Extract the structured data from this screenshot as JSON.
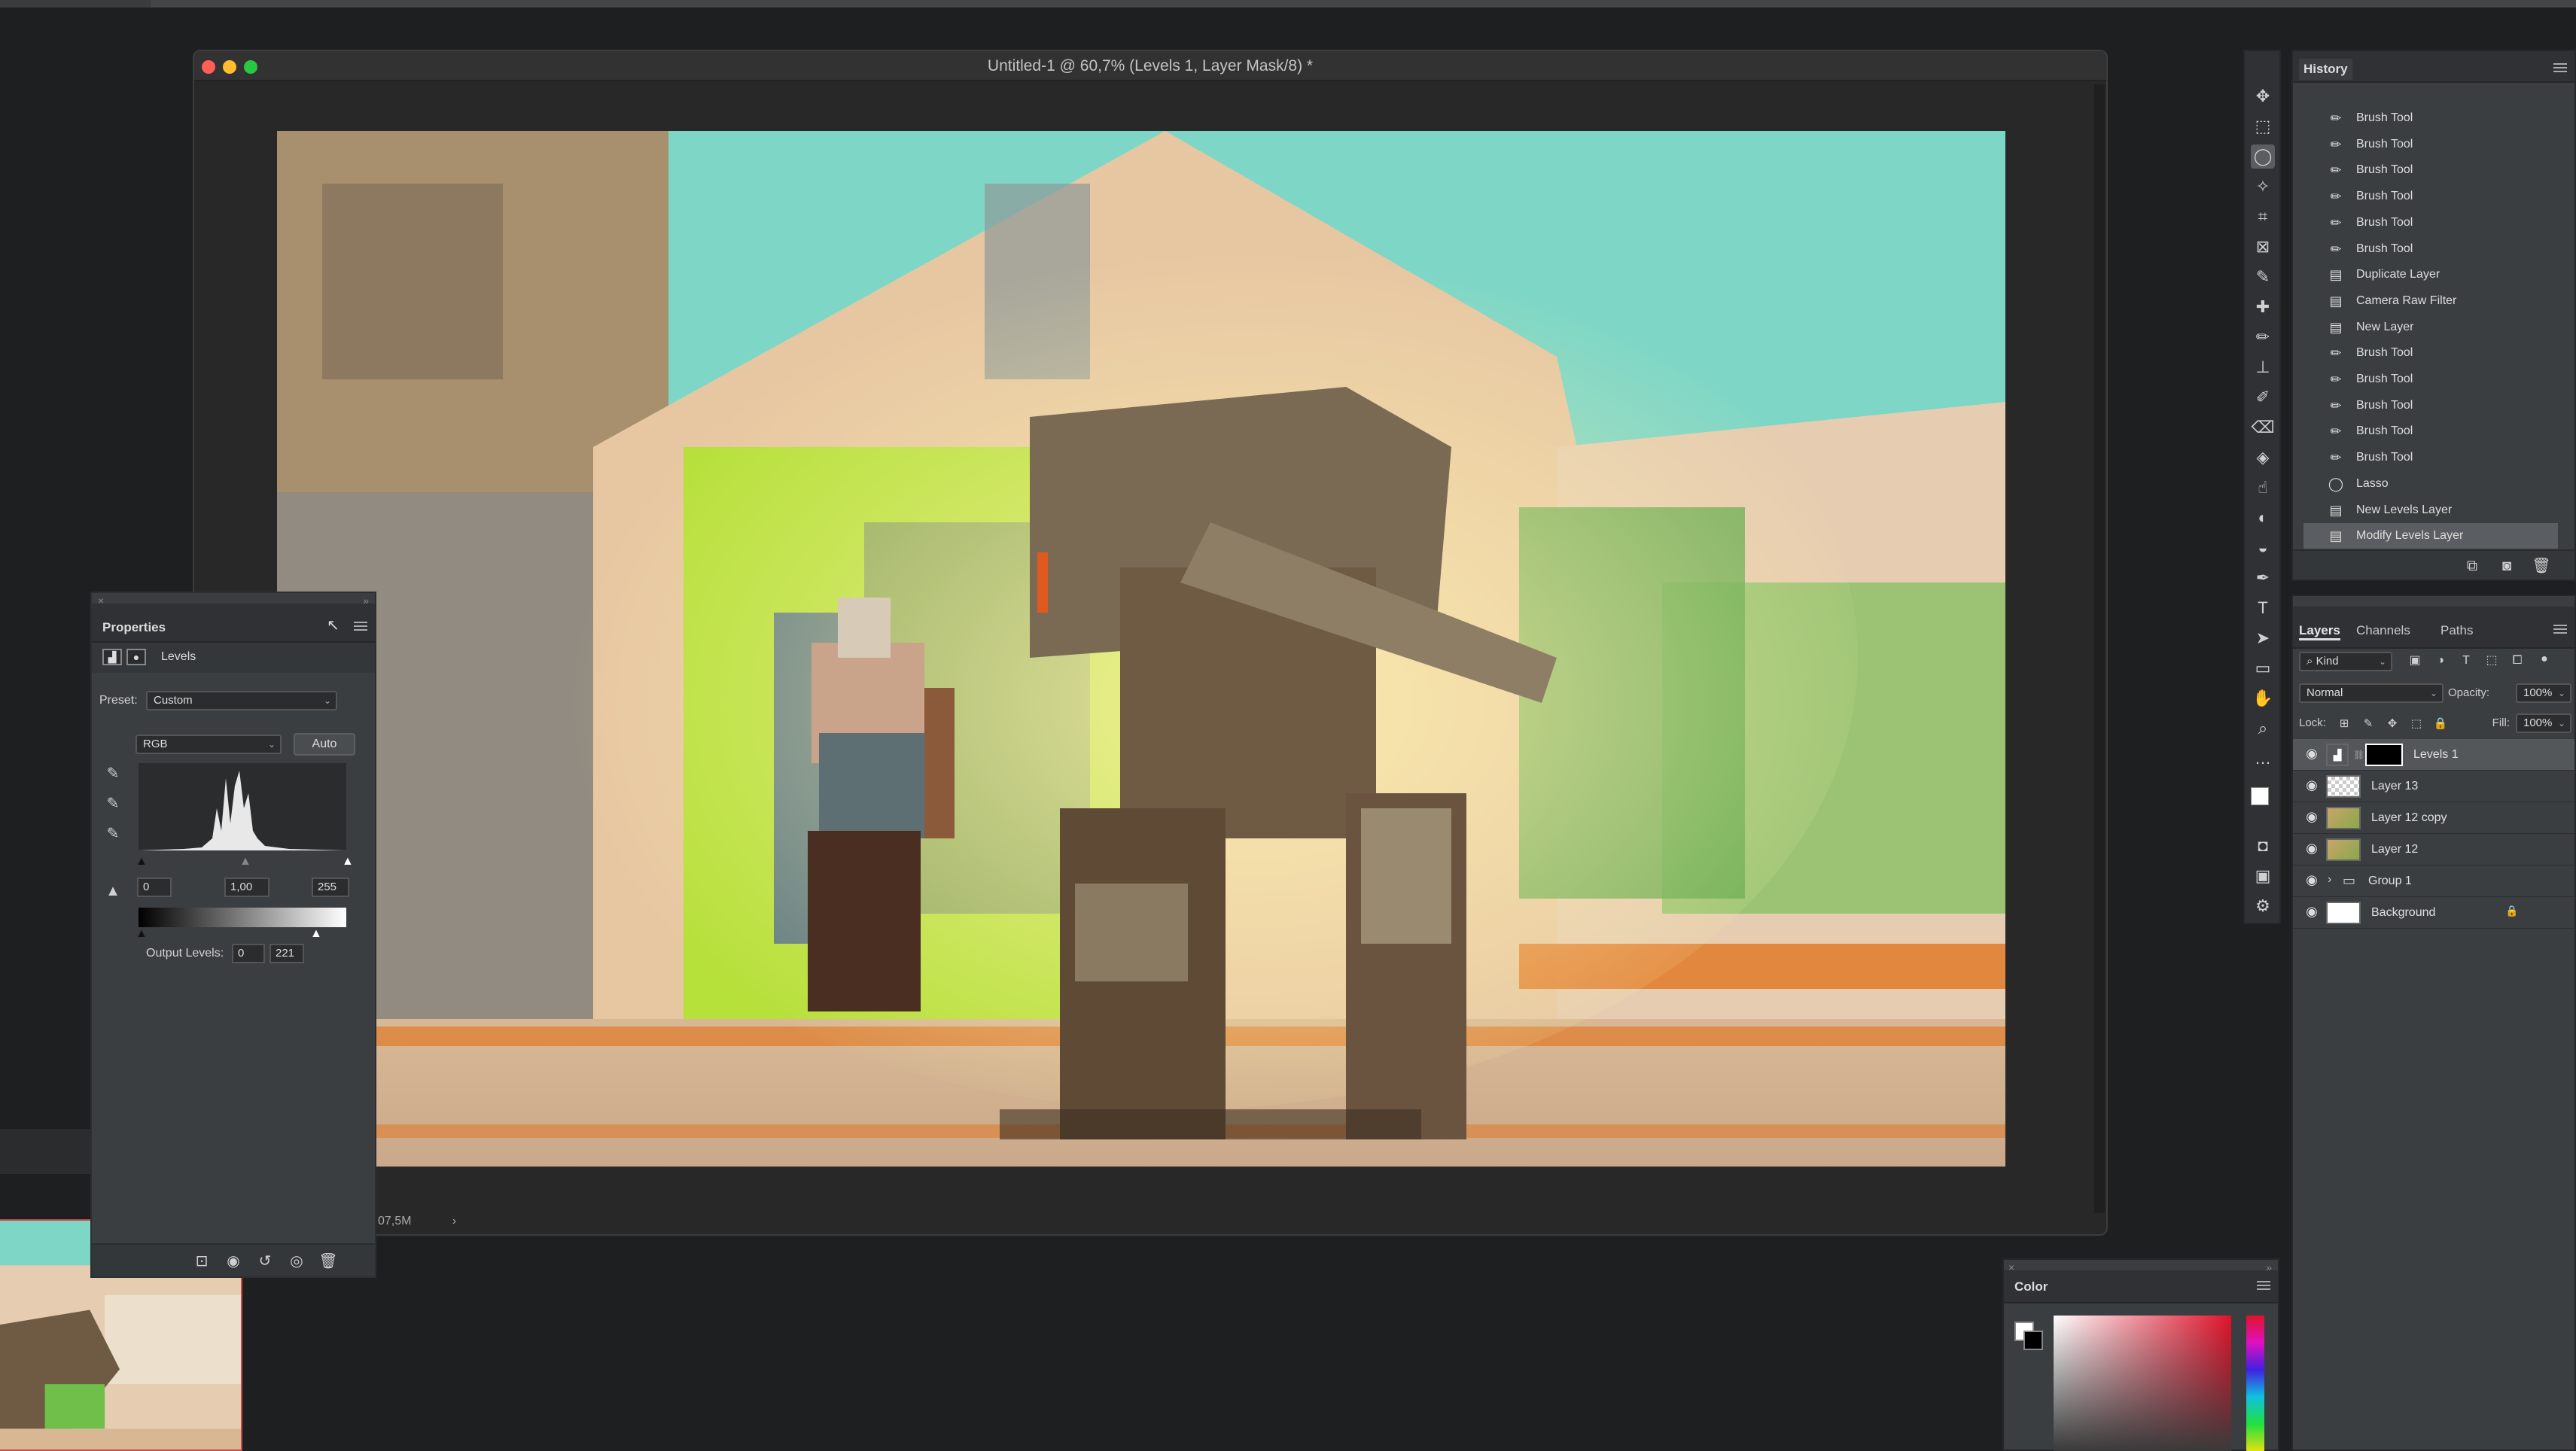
{
  "document": {
    "title": "Untitled-1 @ 60,7% (Levels 1, Layer Mask/8) *",
    "status_text": "07,5M"
  },
  "properties_panel": {
    "tab_label": "Properties",
    "adjustment_label": "Levels",
    "preset_label": "Preset:",
    "preset_value": "Custom",
    "channel_value": "RGB",
    "auto_label": "Auto",
    "input_black": "0",
    "input_gamma": "1,00",
    "input_white": "255",
    "output_label": "Output Levels:",
    "output_black": "0",
    "output_white": "221"
  },
  "history_panel": {
    "tab_label": "History",
    "items": [
      {
        "label": "Brush Tool",
        "icon": "brush-icon"
      },
      {
        "label": "Brush Tool",
        "icon": "brush-icon"
      },
      {
        "label": "Brush Tool",
        "icon": "brush-icon"
      },
      {
        "label": "Brush Tool",
        "icon": "brush-icon"
      },
      {
        "label": "Brush Tool",
        "icon": "brush-icon"
      },
      {
        "label": "Brush Tool",
        "icon": "brush-icon"
      },
      {
        "label": "Duplicate Layer",
        "icon": "document-icon"
      },
      {
        "label": "Camera Raw Filter",
        "icon": "document-icon"
      },
      {
        "label": "New Layer",
        "icon": "document-icon"
      },
      {
        "label": "Brush Tool",
        "icon": "brush-icon"
      },
      {
        "label": "Brush Tool",
        "icon": "brush-icon"
      },
      {
        "label": "Brush Tool",
        "icon": "brush-icon"
      },
      {
        "label": "Brush Tool",
        "icon": "brush-icon"
      },
      {
        "label": "Brush Tool",
        "icon": "brush-icon"
      },
      {
        "label": "Lasso",
        "icon": "lasso-icon"
      },
      {
        "label": "New Levels Layer",
        "icon": "document-icon"
      },
      {
        "label": "Modify Levels Layer",
        "icon": "document-icon"
      }
    ]
  },
  "layers_panel": {
    "tabs": [
      "Layers",
      "Channels",
      "Paths"
    ],
    "filter_kind": "Kind",
    "blend_mode": "Normal",
    "opacity_label": "Opacity:",
    "opacity_value": "100%",
    "lock_label": "Lock:",
    "fill_label": "Fill:",
    "fill_value": "100%",
    "layers": [
      {
        "name": "Levels 1"
      },
      {
        "name": "Layer 13"
      },
      {
        "name": "Layer 12 copy"
      },
      {
        "name": "Layer 12"
      },
      {
        "name": "Group 1"
      },
      {
        "name": "Background"
      }
    ]
  },
  "color_panel": {
    "tab_label": "Color"
  },
  "colors": {
    "sky": "#7ed6c6",
    "wall": "#e6c9a6",
    "door_green": "#b6e03a",
    "ground_orange": "#e07a2a",
    "robot": "#6f5a44",
    "spectrum_red": "#e0122a"
  }
}
